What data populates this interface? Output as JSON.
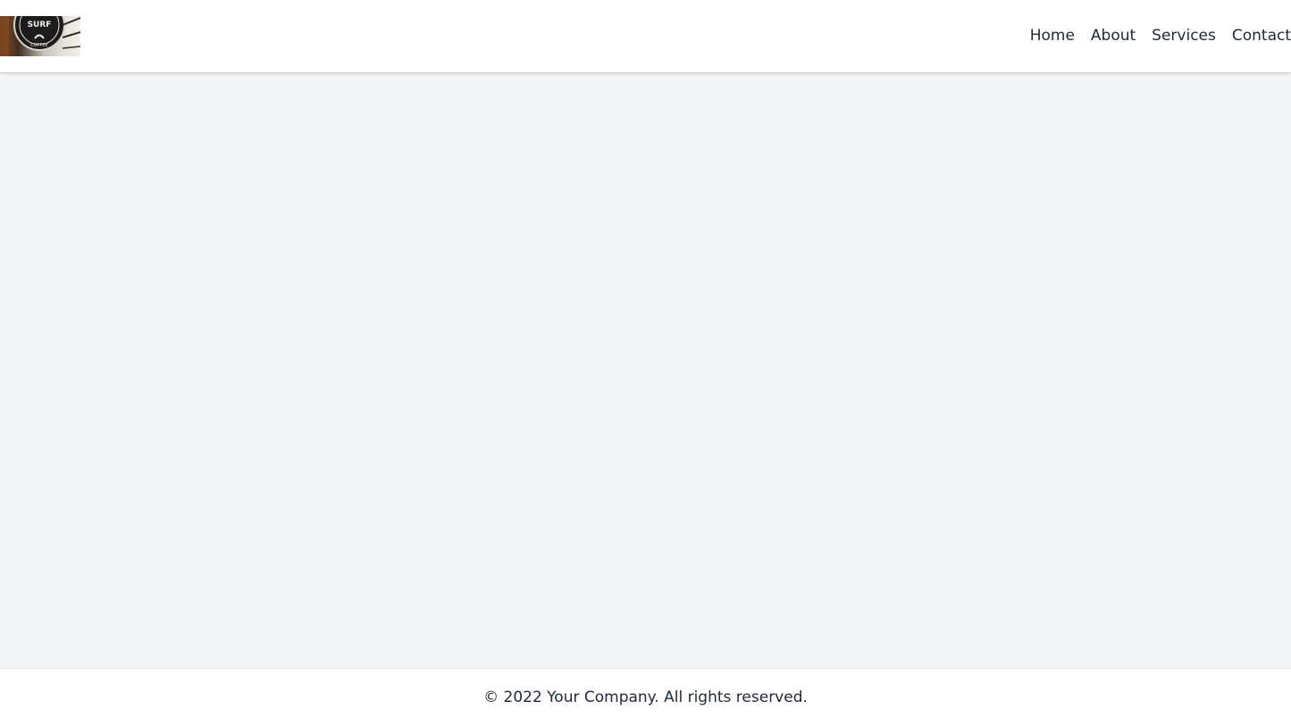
{
  "header": {
    "logo": {
      "icon": "surf-coffee-logo-icon",
      "alt_text": "SURF COFFEE"
    },
    "nav": [
      {
        "label": "Home"
      },
      {
        "label": "About"
      },
      {
        "label": "Services"
      },
      {
        "label": "Contact"
      }
    ]
  },
  "footer": {
    "copyright": "© 2022 Your Company. All rights reserved."
  },
  "colors": {
    "page_background": "#f3f4f6",
    "header_background": "#ffffff",
    "footer_background": "#ffffff",
    "text": "#1f2937"
  }
}
